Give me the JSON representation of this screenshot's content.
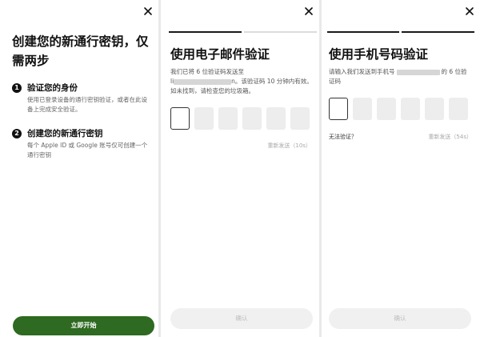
{
  "screen1": {
    "title": "创建您的新通行密钥，仅需两步",
    "steps": [
      {
        "number": "1",
        "title": "验证您的身份",
        "description": "使用已登录设备的通行密钥验证，或者在此设备上完成安全验证。"
      },
      {
        "number": "2",
        "title": "创建您的新通行密钥",
        "description": "每个 Apple ID 或 Google 账号仅可创建一个通行密钥"
      }
    ],
    "start_button": "立即开始",
    "close_icon": "close-icon"
  },
  "screen2": {
    "title": "使用电子邮件验证",
    "desc_line1": "我们已将 6 位验证码发送至",
    "email_prefix": "li",
    "email_suffix": "n。该验证码 10 分钟内有效。如未找到，请检查您的垃圾箱。",
    "code_length": 6,
    "resend": "重新发送（10s）",
    "confirm_button": "确认"
  },
  "screen3": {
    "title": "使用手机号码验证",
    "desc_prefix": "请输入我们发送到手机号",
    "desc_suffix": "的 6 位验证码",
    "code_length": 6,
    "no_verify": "无法验证？",
    "resend": "重新发送（54s）",
    "confirm_button": "确认"
  },
  "colors": {
    "primary_button": "#2e6a21",
    "disabled_button": "#f0f0f0",
    "progress_active": "#1a1a1a",
    "progress_inactive": "#dcdcdc"
  }
}
